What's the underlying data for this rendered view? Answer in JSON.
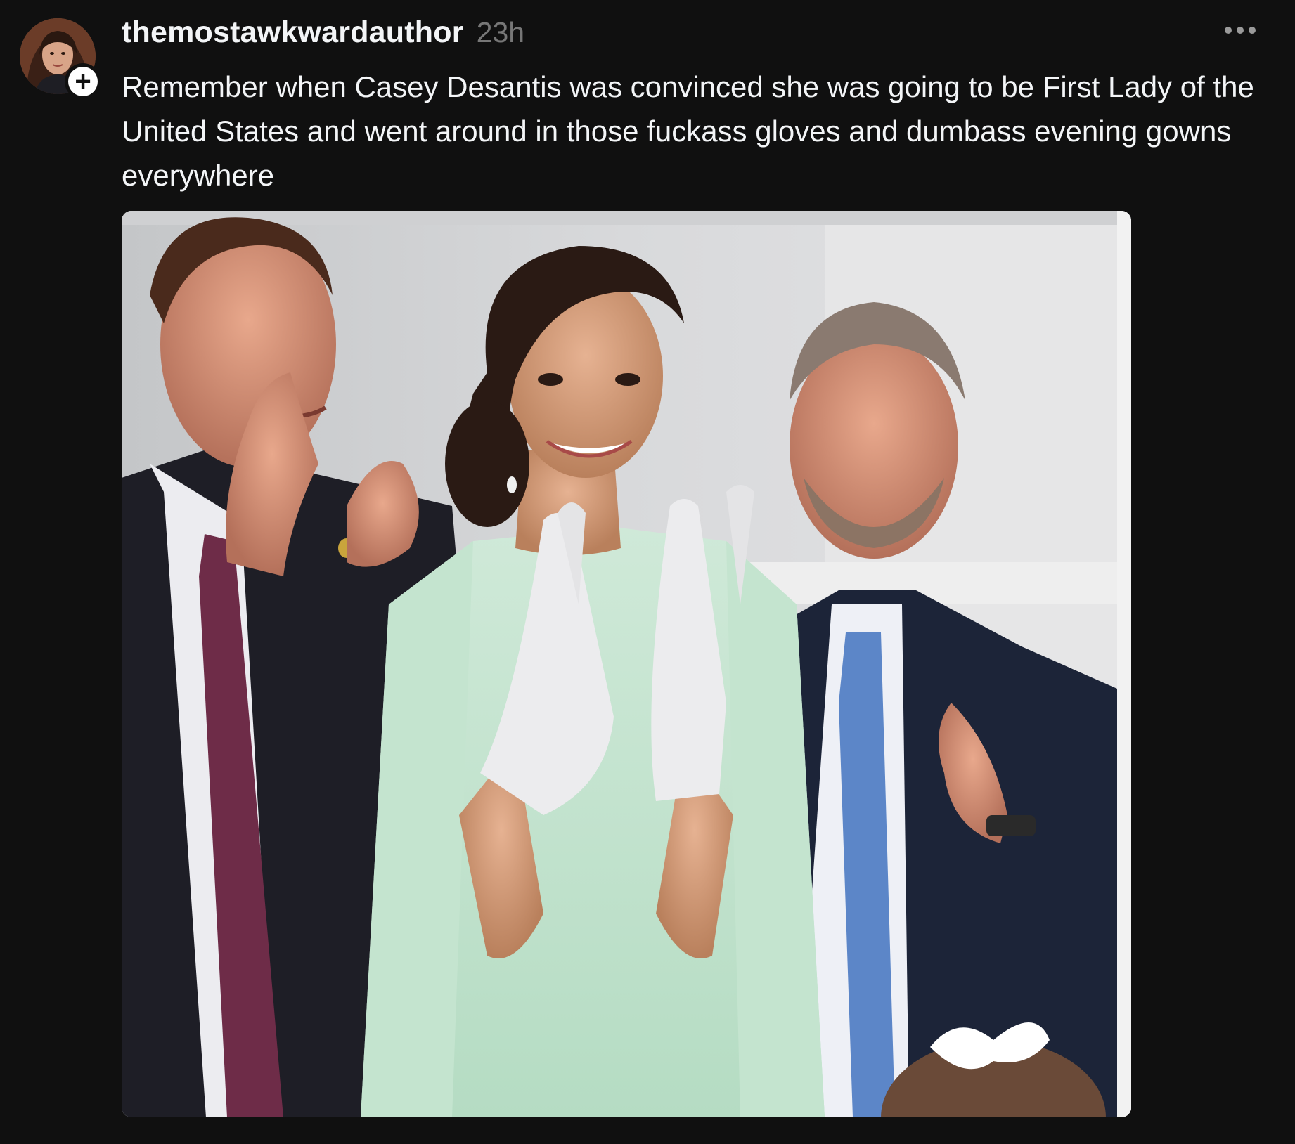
{
  "post": {
    "username": "themostawkwardauthor",
    "timestamp": "23h",
    "text": "Remember when Casey Desantis was convinced she was going to be First Lady of the United States and went around in those fuckass gloves and dumbass evening gowns everywhere",
    "follow_symbol": "+",
    "more_icon": "ellipsis-icon",
    "avatar_icon": "profile-photo"
  }
}
